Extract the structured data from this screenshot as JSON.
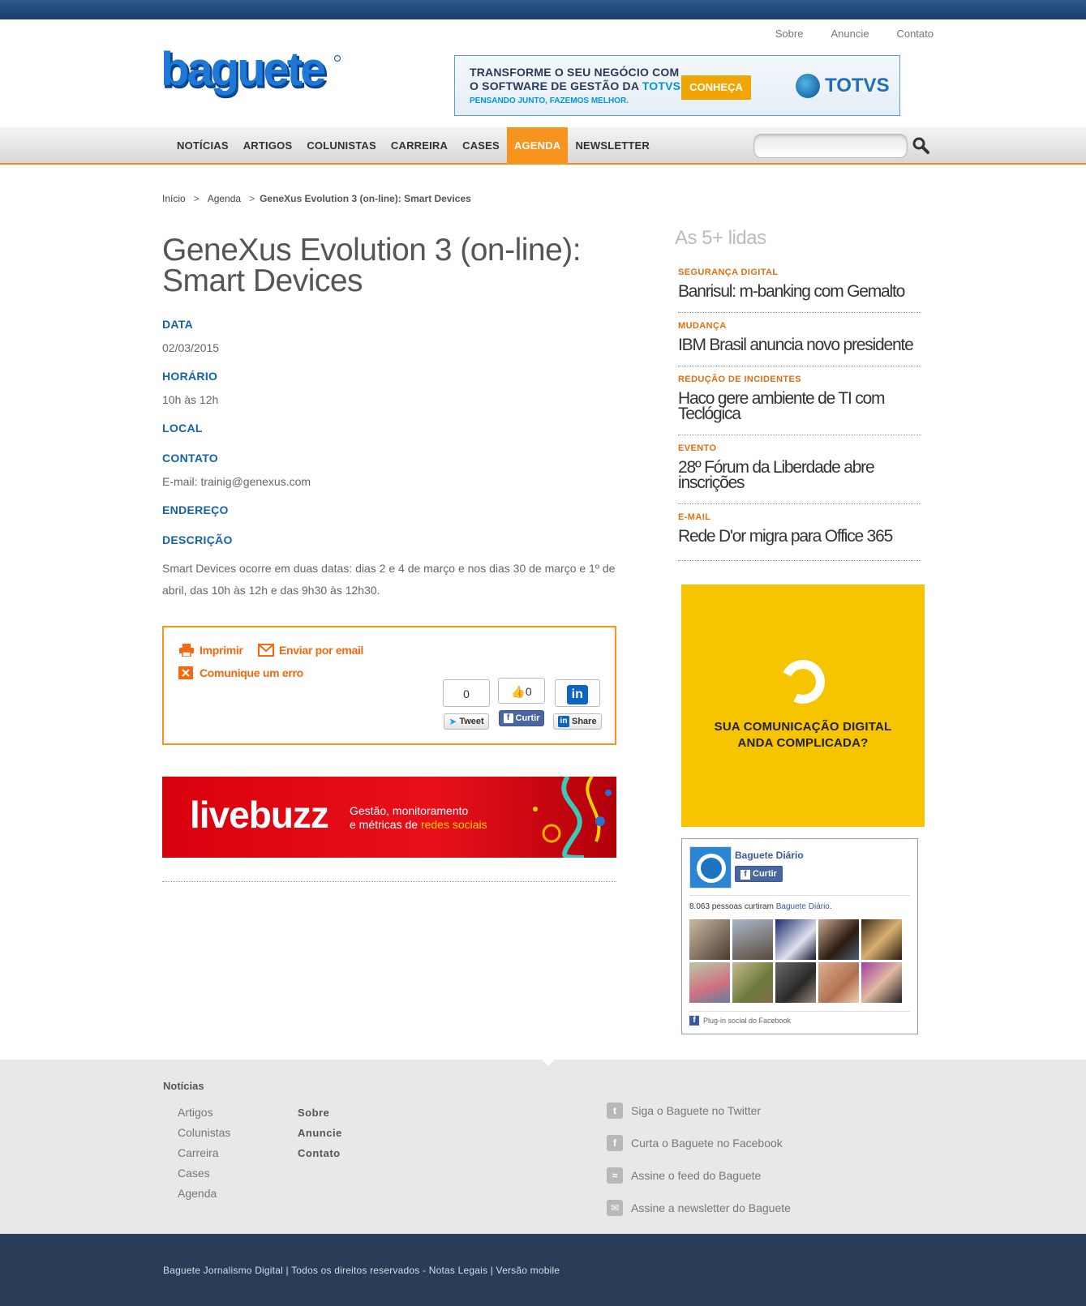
{
  "top_links": [
    "Sobre",
    "Anuncie",
    "Contato"
  ],
  "header_ad": {
    "line1": "TRANSFORME O SEU NEGÓCIO COM",
    "line2a": "O SOFTWARE DE GESTÃO DA ",
    "line2b": "TOTVS",
    "line2c": ".",
    "line3": "PENSANDO JUNTO, FAZEMOS MELHOR.",
    "cta": "CONHEÇA",
    "brand": "TOTVS"
  },
  "nav": [
    "NOTÍCIAS",
    "ARTIGOS",
    "COLUNISTAS",
    "CARREIRA",
    "CASES",
    "AGENDA",
    "NEWSLETTER"
  ],
  "nav_active": "AGENDA",
  "search": {
    "placeholder": ""
  },
  "breadcrumb": {
    "home": "Início",
    "sep1": ">",
    "section": "Agenda",
    "sep2": ">",
    "current": "GeneXus Evolution 3 (on-line): Smart Devices"
  },
  "article": {
    "title": "GeneXus Evolution 3 (on-line): Smart Devices",
    "fields": {
      "data_label": "DATA",
      "data_value": "02/03/2015",
      "horario_label": "HORÁRIO",
      "horario_value": "10h às 12h",
      "local_label": "LOCAL",
      "contato_label": "CONTATO",
      "contato_value": "E-mail: trainig@genexus.com",
      "endereco_label": "ENDEREÇO",
      "descricao_label": "DESCRIÇÃO"
    },
    "description": "Smart Devices ocorre em duas datas: dias 2 e 4 de março e nos dias 30 de março e 1º de abril, das 10h às 12h e das 9h30 às 12h30."
  },
  "share": {
    "print": "Imprimir",
    "email": "Enviar por email",
    "error": "Comunique um erro",
    "tweet_count": "0",
    "tweet_label": "Tweet",
    "fb_count": "0",
    "fb_label": "Curtir",
    "li_label": "Share"
  },
  "livebuzz": {
    "logo": "livebuzz",
    "tag1": "Gestão, monitoramento",
    "tag2a": "e métricas de ",
    "tag2b": "redes sociais"
  },
  "sidebar": {
    "title": "As 5+ lidas",
    "items": [
      {
        "category": "SEGURANÇA DIGITAL",
        "headline": "Banrisul: m-banking com Gemalto"
      },
      {
        "category": "MUDANÇA",
        "headline": "IBM Brasil anuncia novo presidente"
      },
      {
        "category": "REDUÇÃO DE INCIDENTES",
        "headline": "Haco gere ambiente de TI com Teclógica"
      },
      {
        "category": "EVENTO",
        "headline": "28º Fórum da Liberdade abre inscrições"
      },
      {
        "category": "E-MAIL",
        "headline": "Rede D'or migra para Office 365"
      }
    ]
  },
  "yellow_ad": {
    "line1": "SUA COMUNICAÇÃO DIGITAL",
    "line2": "ANDA COMPLICADA?"
  },
  "fb_box": {
    "page_name": "Baguete Diário",
    "like_label": "Curtir",
    "count_text": "8.063 pessoas curtiram ",
    "count_page": "Baguete Diário",
    "count_end": ".",
    "plugin": "Plug-in social do Facebook"
  },
  "footer": {
    "heading": "Notícias",
    "col1": [
      "Artigos",
      "Colunistas",
      "Carreira",
      "Cases",
      "Agenda"
    ],
    "col2": [
      "Sobre",
      "Anuncie",
      "Contato"
    ],
    "social": [
      "Siga o Baguete no Twitter",
      "Curta o Baguete no Facebook",
      "Assine o feed do Baguete",
      "Assine a newsletter do Baguete"
    ]
  },
  "bottom_text": "Baguete Jornalismo Digital | Todos os direitos reservados - Notas Legais | Versão mobile",
  "colors": {
    "accent_orange": "#f7941d",
    "label_blue": "#1463a8",
    "footer_dark": "#2a3d57",
    "ad_yellow": "#f7c400"
  }
}
